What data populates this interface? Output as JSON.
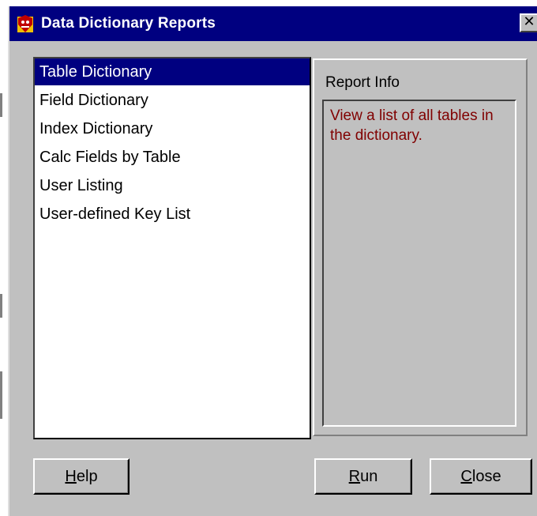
{
  "window": {
    "title": "Data Dictionary Reports",
    "close_glyph": "✕"
  },
  "report_list": {
    "selected_index": 0,
    "items": [
      {
        "label": "Table Dictionary"
      },
      {
        "label": "Field Dictionary"
      },
      {
        "label": "Index Dictionary"
      },
      {
        "label": "Calc Fields by Table"
      },
      {
        "label": "User Listing"
      },
      {
        "label": "User-defined Key List"
      }
    ]
  },
  "report_info": {
    "label": "Report Info",
    "description": "View a list of all tables in the dictionary."
  },
  "buttons": {
    "help": {
      "mnemonic": "H",
      "rest": "elp"
    },
    "run": {
      "mnemonic": "R",
      "rest": "un"
    },
    "close": {
      "mnemonic": "C",
      "rest": "lose"
    }
  },
  "colors": {
    "titlebar": "#000080",
    "selection": "#000080",
    "face": "#c0c0c0",
    "info_text": "#800000"
  },
  "icons": {
    "app": "app-icon",
    "close": "close-icon"
  }
}
